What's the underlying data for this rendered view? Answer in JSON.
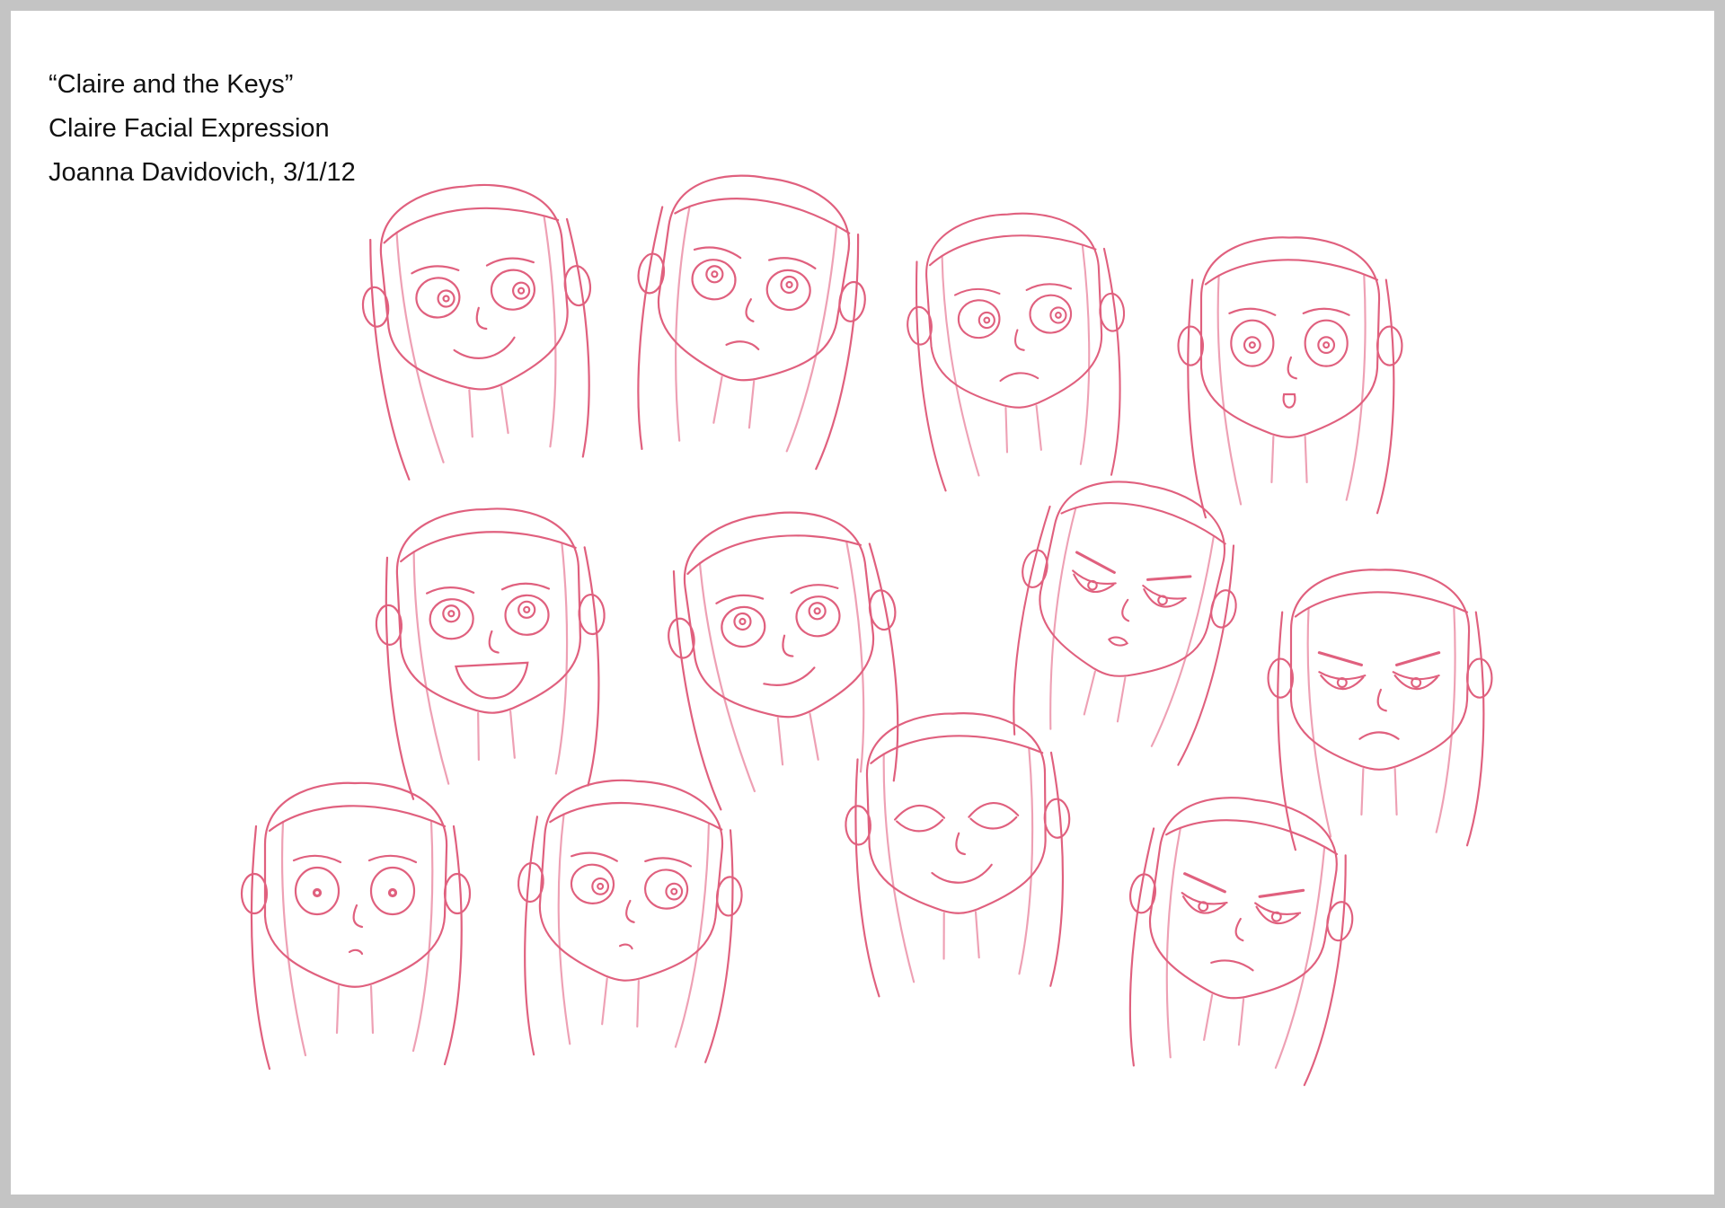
{
  "sheet": {
    "title": "“Claire and the Keys”",
    "subtitle": "Claire Facial Expression",
    "credit": "Joanna Davidovich, 3/1/12"
  },
  "colors": {
    "background_border": "#c4c4c4",
    "paper": "#ffffff",
    "pencil": "#e0607e",
    "pencil_light": "#eea0b4",
    "text": "#111111"
  },
  "sketches": [
    {
      "expression": "sly-smile"
    },
    {
      "expression": "worried"
    },
    {
      "expression": "doubtful"
    },
    {
      "expression": "surprised"
    },
    {
      "expression": "laughing"
    },
    {
      "expression": "smirk"
    },
    {
      "expression": "suspicious"
    },
    {
      "expression": "angry"
    },
    {
      "expression": "shocked"
    },
    {
      "expression": "side-glance"
    },
    {
      "expression": "content"
    },
    {
      "expression": "scowl"
    }
  ]
}
